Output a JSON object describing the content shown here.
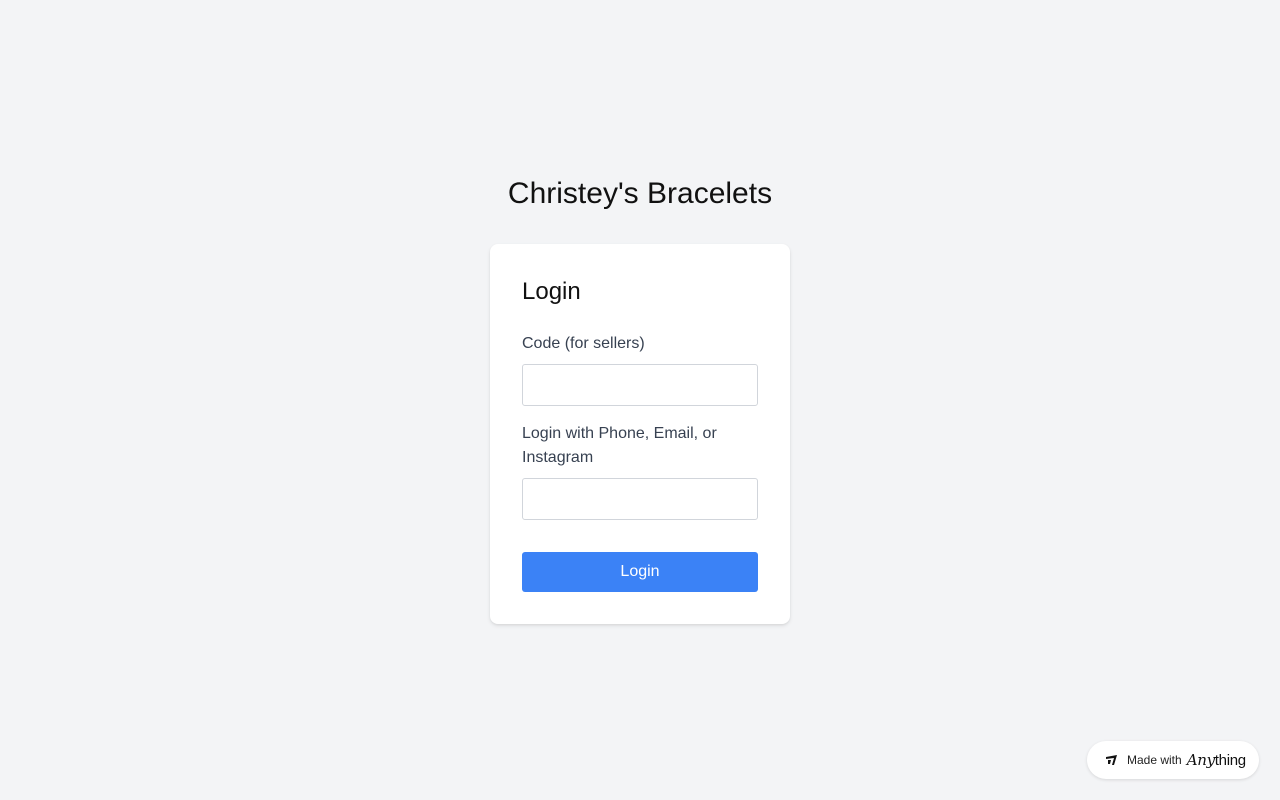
{
  "page": {
    "title": "Christey's Bracelets"
  },
  "login_card": {
    "heading": "Login",
    "code_field": {
      "label": "Code (for sellers)",
      "value": "",
      "placeholder": ""
    },
    "contact_field": {
      "label": "Login with Phone, Email, or Instagram",
      "value": "",
      "placeholder": ""
    },
    "submit_label": "Login"
  },
  "badge": {
    "prefix": "Made with",
    "brand_script": "Any",
    "brand_plain": "thing",
    "icon": "anything-logo-icon"
  },
  "colors": {
    "background": "#f3f4f6",
    "card": "#ffffff",
    "accent": "#3b82f6",
    "label_text": "#374151"
  }
}
